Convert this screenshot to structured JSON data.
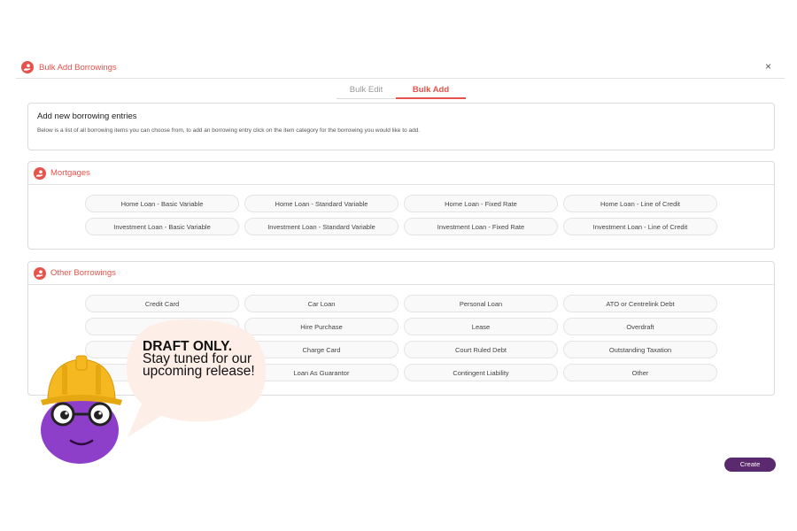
{
  "header": {
    "title": "Bulk Add Borrowings",
    "close_symbol": "×",
    "icon": "hand-coin-icon"
  },
  "tabs": [
    {
      "label": "Bulk Edit",
      "active": false
    },
    {
      "label": "Bulk Add",
      "active": true
    }
  ],
  "intro": {
    "title": "Add new borrowing entries",
    "description": "Below is a list of all borrowing items you can choose from, to add an borrowing entry click on the item category for the borrowing you would like to add."
  },
  "mortgages": {
    "title": "Mortgages",
    "items": [
      "Home Loan - Basic Variable",
      "Home Loan - Standard Variable",
      "Home Loan - Fixed Rate",
      "Home Loan - Line of Credit",
      "Investment Loan - Basic Variable",
      "Investment Loan - Standard Variable",
      "Investment Loan - Fixed Rate",
      "Investment Loan - Line of Credit"
    ]
  },
  "other": {
    "title": "Other Borrowings",
    "items": [
      "Credit Card",
      "Car Loan",
      "Personal Loan",
      "ATO or Centrelink Debt",
      "",
      "Hire Purchase",
      "Lease",
      "Overdraft",
      "",
      "Charge Card",
      "Court Ruled Debt",
      "Outstanding Taxation",
      "",
      "Loan As Guarantor",
      "Contingent Liability",
      "Other"
    ]
  },
  "create_label": "Create",
  "draft": {
    "line1": "DRAFT ONLY.",
    "line2": "Stay tuned for our upcoming release!"
  },
  "colors": {
    "accent": "#e5534b",
    "create_bg": "#5b2a6e",
    "mascot": "#8e3fc9",
    "hat": "#f5b820",
    "bubble": "#fdeee8"
  }
}
